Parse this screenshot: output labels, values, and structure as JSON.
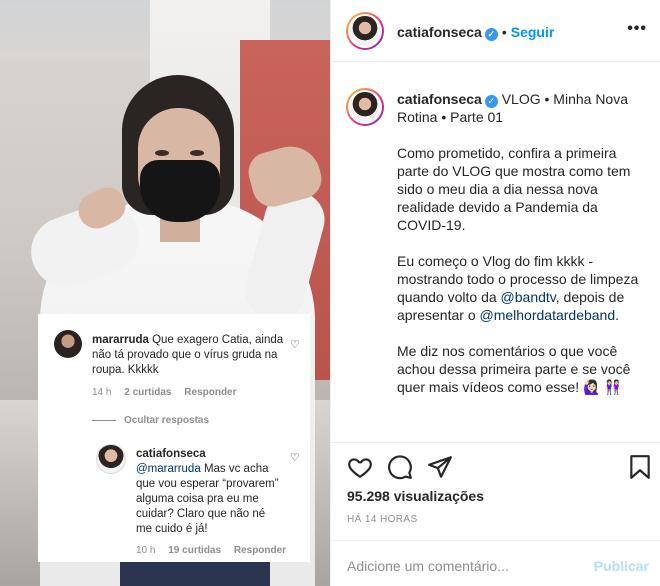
{
  "overlay": {
    "comment1": {
      "username": "mararruda",
      "text": "Que exagero Catia, ainda não tá provado que o vírus gruda na roupa. Kkkkk",
      "time": "14 h",
      "likes": "2 curtidas",
      "reply": "Responder"
    },
    "hide_replies": "Ocultar respostas",
    "comment2": {
      "username": "catiafonseca",
      "mention": "@mararruda",
      "text": "Mas vc acha que vou esperar “provarem” alguma coisa pra eu me cuidar? Claro que não né me cuido é já!",
      "time": "10 h",
      "likes": "19 curtidas",
      "reply": "Responder"
    }
  },
  "header": {
    "username": "catiafonseca",
    "separator": "•",
    "follow": "Seguir",
    "more": "•••"
  },
  "caption": {
    "username": "catiafonseca",
    "title": "VLOG • Minha Nova Rotina • Parte 01",
    "p1": "Como prometido, confira a primeira parte do VLOG que mostra como tem sido o meu dia a dia nessa nova realidade devido a Pandemia da COVID-19.",
    "p2_a": "Eu começo o Vlog do fim kkkk - mostrando todo o processo de limpeza quando volto da ",
    "p2_mention1": "@bandtv",
    "p2_b": ", depois de apresentar o ",
    "p2_mention2": "@melhordatardeband",
    "p2_c": ".",
    "p3": "Me diz nos comentários o que você achou dessa primeira parte e se você quer mais vídeos como esse! 🙋🏻‍♀️ 👭🏻"
  },
  "stats": {
    "views": "95.298 visualizações",
    "time": "HÁ 14 HORAS"
  },
  "comment_box": {
    "placeholder": "Adicione um comentário...",
    "post": "Publicar"
  },
  "icons": {
    "like": "heart-icon",
    "comment": "comment-icon",
    "share": "share-icon",
    "save": "bookmark-icon"
  }
}
